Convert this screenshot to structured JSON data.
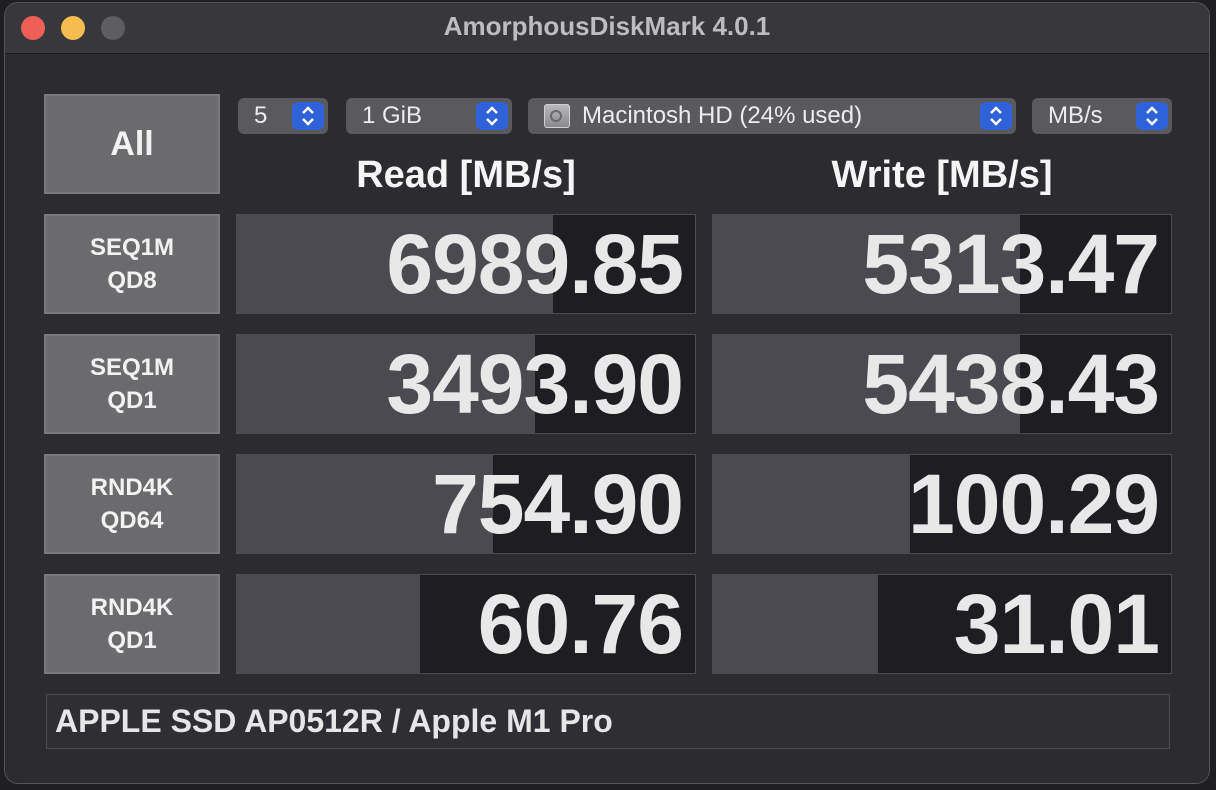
{
  "window": {
    "title": "AmorphousDiskMark 4.0.1"
  },
  "controls": {
    "count": "5",
    "size": "1 GiB",
    "drive": "Macintosh HD (24% used)",
    "unit": "MB/s",
    "icons": {
      "stepper": "updown-chevron-icon",
      "drive": "hard-disk-icon"
    }
  },
  "all_button": "All",
  "headers": {
    "read": "Read [MB/s]",
    "write": "Write [MB/s]"
  },
  "tests": [
    {
      "line1": "SEQ1M",
      "line2": "QD8",
      "read": "6989.85",
      "write": "5313.47",
      "read_fill": 0.69,
      "write_fill": 0.67
    },
    {
      "line1": "SEQ1M",
      "line2": "QD1",
      "read": "3493.90",
      "write": "5438.43",
      "read_fill": 0.65,
      "write_fill": 0.67
    },
    {
      "line1": "RND4K",
      "line2": "QD64",
      "read": "754.90",
      "write": "100.29",
      "read_fill": 0.56,
      "write_fill": 0.43
    },
    {
      "line1": "RND4K",
      "line2": "QD1",
      "read": "60.76",
      "write": "31.01",
      "read_fill": 0.4,
      "write_fill": 0.36
    }
  ],
  "device": "APPLE SSD AP0512R / Apple M1 Pro",
  "colors": {
    "stepper_accent": "#2f62d8",
    "bar_fill": "#4a4a50",
    "cell_bg": "#1e1e22"
  }
}
